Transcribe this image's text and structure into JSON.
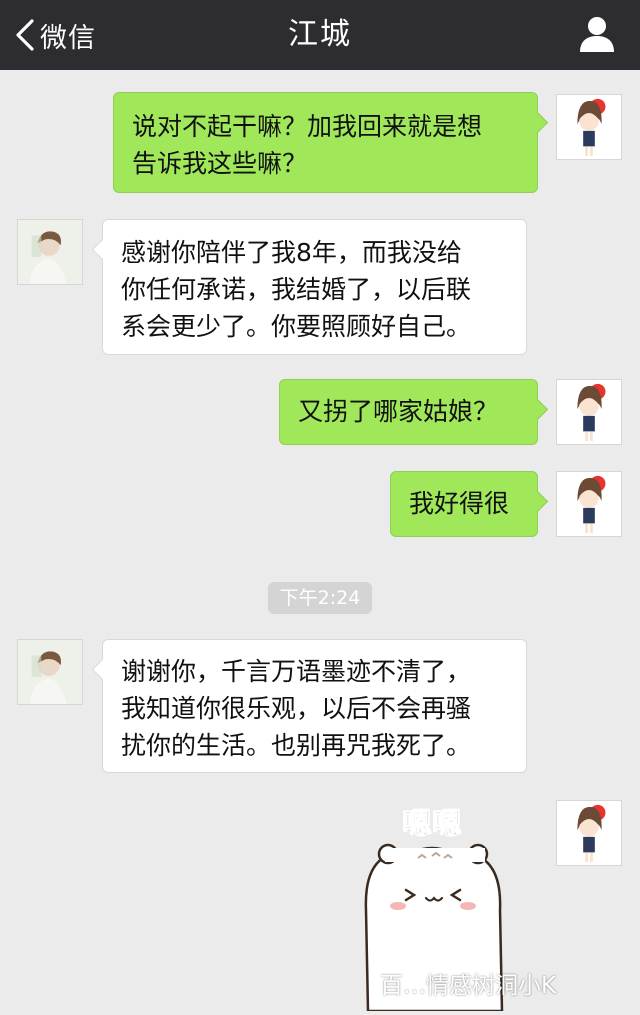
{
  "navbar": {
    "back_label": "微信",
    "title": "江城",
    "profile_icon": "person-icon",
    "background": "#2d2d31"
  },
  "messages": [
    {
      "side": "out",
      "lines": [
        "说对不起干嘛？加我回来就是想",
        "告诉我这些嘛？"
      ]
    },
    {
      "side": "in",
      "lines": [
        "感谢你陪伴了我8年，而我没给",
        "你任何承诺，我结婚了，以后联",
        "系会更少了。你要照顾好自己。"
      ]
    },
    {
      "side": "out",
      "lines": [
        "又拐了哪家姑娘？"
      ]
    },
    {
      "side": "out",
      "lines": [
        "我好得很"
      ]
    },
    {
      "side": "in",
      "lines": [
        "谢谢你，千言万语墨迹不清了，",
        "我知道你很乐观，以后不会再骚",
        "扰你的生活。也别再咒我死了。"
      ]
    }
  ],
  "timestamp": "下午2:24",
  "sticker": {
    "caption": "嗯嗯"
  },
  "watermark": "百…情感树洞小K",
  "colors": {
    "outgoing_bubble": "#a0e75a",
    "incoming_bubble": "#ffffff",
    "chat_background": "#ebebeb"
  }
}
